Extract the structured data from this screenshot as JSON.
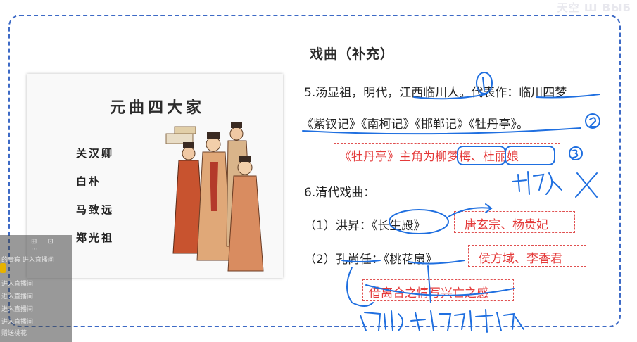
{
  "top_logo": "天空 Ш ВЫБ",
  "slide_title": "戏曲（补充）",
  "image_card": {
    "title": "元曲四大家",
    "poets": [
      "关汉卿",
      "白朴",
      "马致远",
      "郑光祖"
    ]
  },
  "content": {
    "line1": "5.汤显祖，明代，江西临川人。代表作：临川四梦",
    "line2": "《紫钗记》《南柯记》《邯郸记》《牡丹亭》。",
    "box1": "《牡丹亭》主角为柳梦梅、杜丽娘",
    "line3": "6.清代戏曲：",
    "line4": "（1）洪昇：《长生殿》",
    "box2": "唐玄宗、杨贵妃",
    "line5": "（2）孔尚任：《桃花扇》",
    "box3": "侯方域、李香君",
    "box4": "借离合之情写兴亡之感"
  },
  "chat": {
    "icons": "⊞ ⊡ ⋯",
    "lines": [
      "的贵宾 进入直播间",
      "进入直播间",
      "进入直播间",
      "进入直播间",
      "进入直播间",
      "进入直播间",
      "赠送桃花"
    ]
  },
  "colors": {
    "frame": "#3d6ac6",
    "ink": "#1f6fe0",
    "highlight_text": "#e43a3a"
  }
}
